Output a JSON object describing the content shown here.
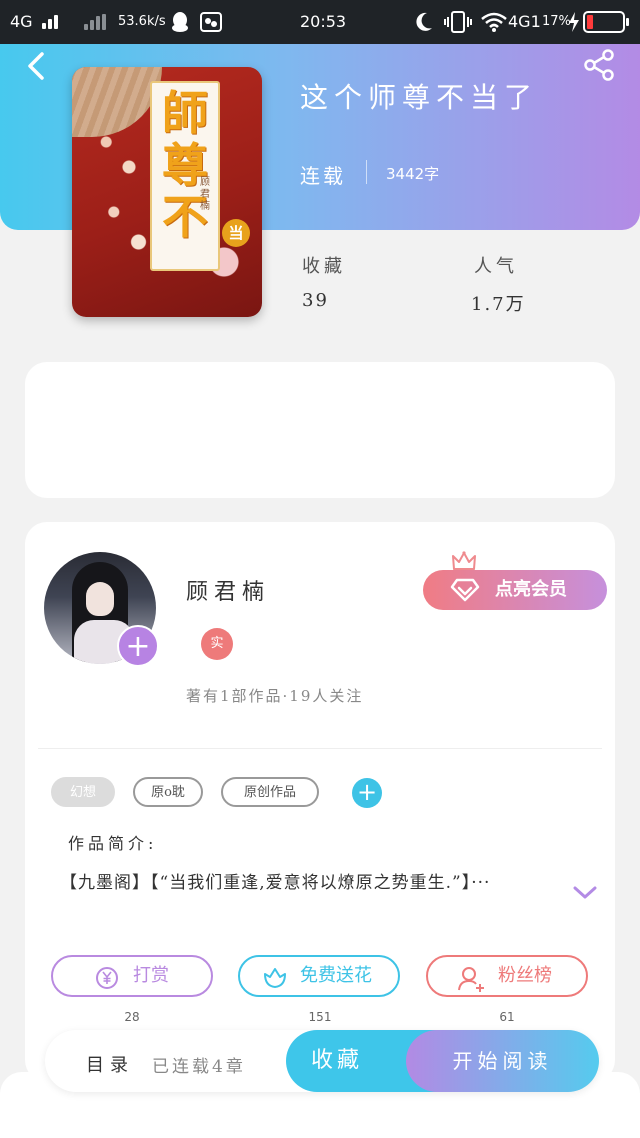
{
  "status_bar": {
    "network": "4G",
    "speed": "53.6k/s",
    "time": "20:53",
    "network2": "4G1",
    "battery_percent": "17%",
    "battery_level": 0.17
  },
  "book": {
    "title": "这个师尊不当了",
    "status": "连载",
    "word_count": "3442字",
    "cover": {
      "title_text": "師尊不",
      "badge": "当",
      "author_text": "顾君楠"
    },
    "stats": [
      {
        "label": "收藏",
        "value": "39"
      },
      {
        "label": "人气",
        "value": "1.7万"
      }
    ]
  },
  "author": {
    "name": "顾君楠",
    "verified_badge": "实",
    "stats_text": "著有1部作品·19人关注",
    "vip_button": "点亮会员"
  },
  "tags": [
    "幻想",
    "原o耽",
    "原创作品"
  ],
  "intro": {
    "label": "作品简介:",
    "text": "【九墨阁】【“当我们重逢,爱意将以燎原之势重生.”】···"
  },
  "actions": [
    {
      "label": "打赏",
      "count": "28",
      "color": "#b98ae0"
    },
    {
      "label": "免费送花",
      "count": "151",
      "color": "#3ec3e6"
    },
    {
      "label": "粉丝榜",
      "count": "61",
      "color": "#ee7a7a"
    }
  ],
  "bottom": {
    "toc": "目录",
    "serial_info": "已连载4章",
    "collect": "收藏",
    "read": "开始阅读"
  },
  "colors": {
    "header_gradient_start": "#47c9ee",
    "header_gradient_end": "#b38be5",
    "accent_blue": "#3ec6ea",
    "accent_purple": "#b783e3",
    "accent_red": "#ee7a7a"
  }
}
